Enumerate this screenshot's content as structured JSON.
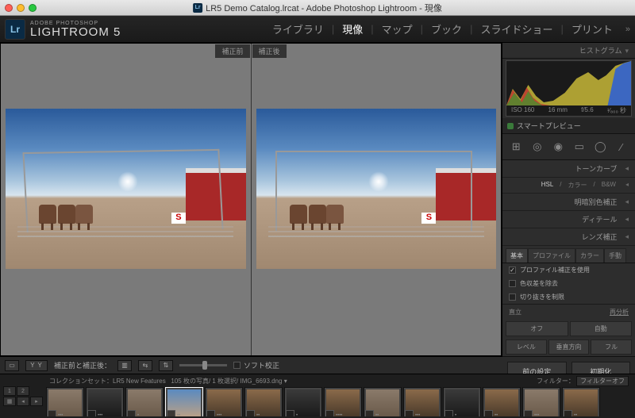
{
  "titlebar": {
    "title": "LR5 Demo Catalog.lrcat - Adobe Photoshop Lightroom - 現像"
  },
  "brand": {
    "sup": "ADOBE PHOTOSHOP",
    "main": "LIGHTROOM 5",
    "logo": "Lr"
  },
  "modules": {
    "library": "ライブラリ",
    "develop": "現像",
    "map": "マップ",
    "book": "ブック",
    "slideshow": "スライドショー",
    "print": "プリント",
    "expand": "»"
  },
  "compare": {
    "before_label": "補正前",
    "after_label": "補正後"
  },
  "right": {
    "histogram_header": "ヒストグラム",
    "meta_iso": "ISO 160",
    "meta_focal": "16 mm",
    "meta_aperture": "f/5.6",
    "meta_shutter": "¹⁄₈₀₀ 秒",
    "smart_preview": "スマートプレビュー",
    "tone_curve": "トーンカーブ",
    "hsl": "HSL",
    "color": "カラー",
    "bw": "B&W",
    "split_toning": "明暗別色補正",
    "detail": "ディテール",
    "lens_correction": "レンズ補正",
    "tabs": {
      "basic": "基本",
      "profile": "プロファイル",
      "color_tab": "カラー",
      "manual": "手動"
    },
    "checks": {
      "enable_profile": "プロファイル補正を使用",
      "remove_ca": "色収差を除去",
      "constrain_crop": "切り抜きを制限"
    },
    "upright_label": "直立",
    "reanalyze": "再分析",
    "buttons": {
      "off": "オフ",
      "auto": "自動",
      "level": "レベル",
      "vertical": "垂直方向",
      "full": "フル"
    },
    "previous": "前の設定",
    "reset": "初期化"
  },
  "toolbar": {
    "before_after_label": "補正前と補正後：",
    "soft_proof": "ソフト校正"
  },
  "filmstrip": {
    "collection_label": "コレクションセット：LR5 New Features",
    "count": "105 枚の写真/ 1 枚選択/",
    "filename": "IMG_6693.dng",
    "filter_label": "フィルター：",
    "filter_value": "フィルターオフ"
  }
}
